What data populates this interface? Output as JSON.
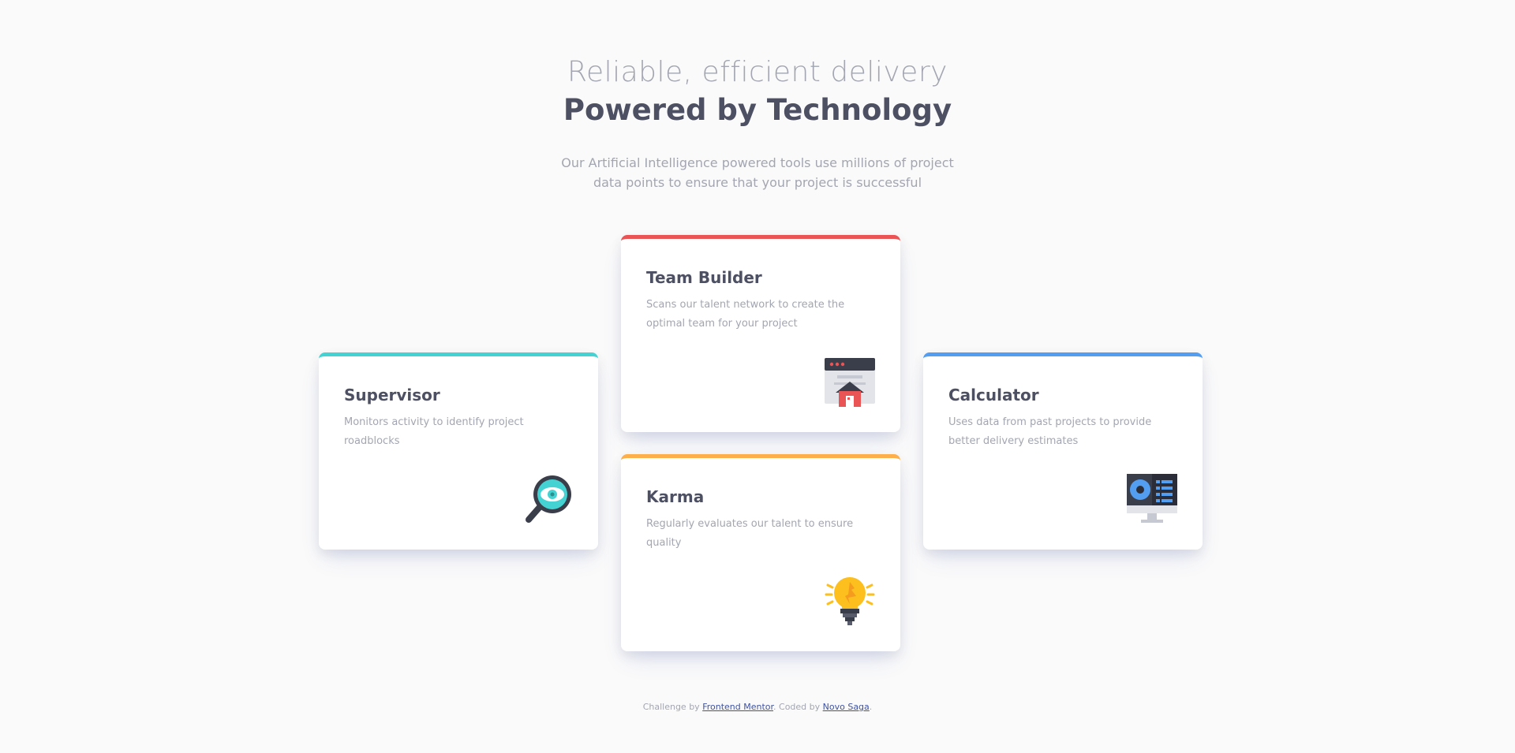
{
  "header": {
    "headline_light": "Reliable, efficient delivery",
    "headline_bold": "Powered by Technology",
    "intro": "Our Artificial Intelligence powered tools use millions of project data points to ensure that your project is successful"
  },
  "cards": {
    "supervisor": {
      "title": "Supervisor",
      "description": "Monitors activity to identify project roadblocks",
      "accent": "#44d3d2",
      "icon": "supervisor-icon"
    },
    "team_builder": {
      "title": "Team Builder",
      "description": "Scans our talent network to create the optimal team for your project",
      "accent": "#ea5454",
      "icon": "team-builder-icon"
    },
    "karma": {
      "title": "Karma",
      "description": "Regularly evaluates our talent to ensure quality",
      "accent": "#fcaf4a",
      "icon": "karma-icon"
    },
    "calculator": {
      "title": "Calculator",
      "description": "Uses data from past projects to provide better delivery estimates",
      "accent": "#549ef2",
      "icon": "calculator-icon"
    }
  },
  "footer": {
    "prefix": "Challenge by ",
    "link1": "Frontend Mentor",
    "middle": ". Coded by ",
    "link2": "Novo Saga",
    "suffix": "."
  }
}
